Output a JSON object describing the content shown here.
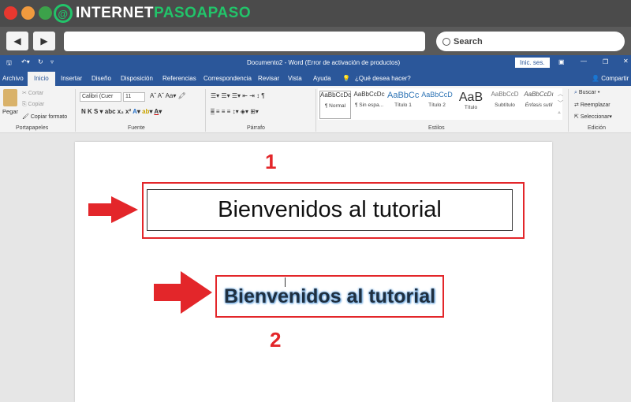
{
  "browser": {
    "logo_text_1": "INTERNET",
    "logo_text_2": "PASOAPASO",
    "back": "◀",
    "forward": "▶",
    "search_label": "Search"
  },
  "window": {
    "title": "Documento2 - Word (Error de activación de productos)",
    "sign_in": "Inic. ses.",
    "share": "Compartir"
  },
  "tabs": [
    "Archivo",
    "Inicio",
    "Insertar",
    "Diseño",
    "Disposición",
    "Referencias",
    "Correspondencia",
    "Revisar",
    "Vista",
    "Ayuda"
  ],
  "tell_me": "¿Qué desea hacer?",
  "ribbon": {
    "clipboard": {
      "paste": "Pegar",
      "cut": "Cortar",
      "copy": "Copiar",
      "format_painter": "Copiar formato",
      "label": "Portapapeles"
    },
    "font": {
      "name": "Calibri (Cuer",
      "size": "11",
      "label": "Fuente"
    },
    "paragraph": {
      "label": "Párrafo"
    },
    "styles": {
      "label": "Estilos",
      "items": [
        {
          "preview": "AaBbCcDc",
          "name": "¶ Normal"
        },
        {
          "preview": "AaBbCcDc",
          "name": "¶ Sin espa..."
        },
        {
          "preview": "AaBbCc",
          "name": "Título 1"
        },
        {
          "preview": "AaBbCcD",
          "name": "Título 2"
        },
        {
          "preview": "AaB",
          "name": "Título"
        },
        {
          "preview": "AaBbCcD",
          "name": "Subtítulo"
        },
        {
          "preview": "AaBbCcDı",
          "name": "Énfasis sutil"
        }
      ]
    },
    "editing": {
      "find": "Buscar",
      "replace": "Reemplazar",
      "select": "Seleccionar",
      "label": "Edición"
    }
  },
  "document": {
    "label_1": "1",
    "label_2": "2",
    "text_1": "Bienvenidos al tutorial",
    "text_2": "Bienvenidos al tutorial"
  },
  "colors": {
    "word_blue": "#2b579a",
    "annotation_red": "#e3262a",
    "brand_green": "#22c46a"
  }
}
